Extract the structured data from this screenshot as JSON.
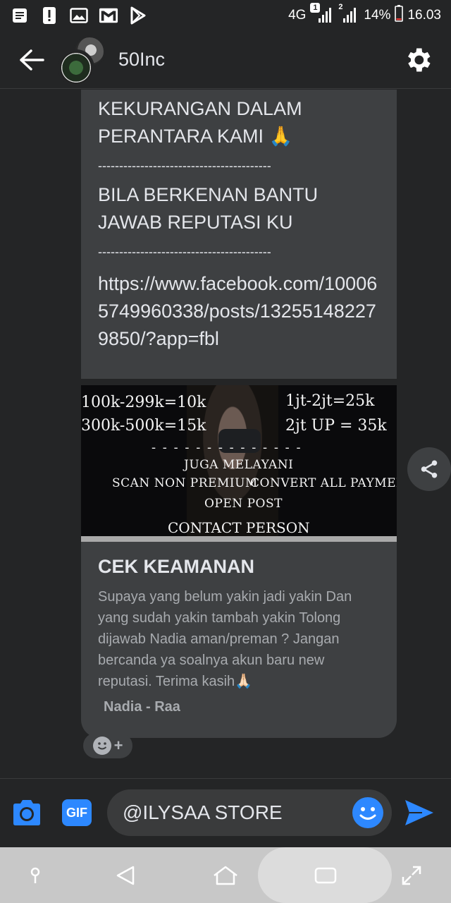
{
  "status_bar": {
    "network": "4G",
    "sim1_badge": "1",
    "sim2_badge": "2",
    "battery": "14%",
    "time": "16.03"
  },
  "header": {
    "title": "50Inc"
  },
  "message": {
    "line1": "KEKURANGAN DALAM",
    "line2": "PERANTARA KAMI 🙏",
    "separator1": "-----------------------------------------",
    "line3": "BILA BERKENAN BANTU",
    "line4": "JAWAB REPUTASI KU",
    "separator2": "-----------------------------------------",
    "link": "https://www.facebook.com/100065749960338/posts/132551482279850/?app=fbl"
  },
  "link_preview": {
    "image_text": {
      "price1": "100k-299k=10k",
      "price2": "1jt-2jt=25k",
      "price3": "300k-500k=15k",
      "price4": "2jt UP = 35k",
      "dashes": "- - - - - - - - - - - - - -",
      "juga": "JUGA MELAYANI",
      "scan": "SCAN NON PREMIUM",
      "convert": "CONVERT ALL PAYMENT",
      "open": "OPEN POST",
      "contact": "CONTACT PERSON"
    },
    "title": "CEK KEAMANAN",
    "description": "Supaya yang belum yakin jadi yakin Dan yang sudah yakin tambah yakin Tolong dijawab Nadia aman/preman ? Jangan bercanda ya soalnya akun baru new reputasi. Terima kasih🙏🏻",
    "author": "Nadia - Raa"
  },
  "composer": {
    "gif_label": "GIF",
    "input_value": "@ILYSAA STORE"
  },
  "colors": {
    "background": "#242526",
    "bubble": "#3e4042",
    "accent": "#2d88ff",
    "navbar": "#c8c8c8"
  }
}
